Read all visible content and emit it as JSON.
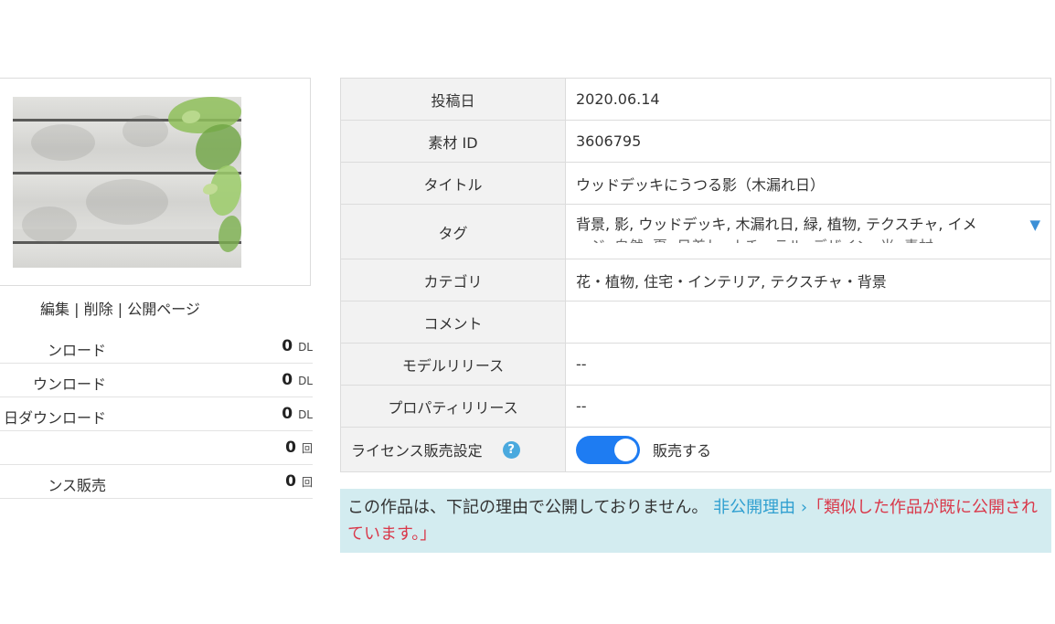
{
  "item_actions": {
    "edit": "編集",
    "separator": "|",
    "delete": "削除",
    "public_page": "公開ページ"
  },
  "stats": [
    {
      "label": "ンロード",
      "value": "0",
      "unit": "DL"
    },
    {
      "label": "ウンロード",
      "value": "0",
      "unit": "DL"
    },
    {
      "label": "日ダウンロード",
      "value": "0",
      "unit": "DL"
    },
    {
      "label": "",
      "value": "0",
      "unit": "回"
    },
    {
      "label": "ンス販売",
      "value": "0",
      "unit": "回"
    }
  ],
  "info": {
    "post_date": {
      "label": "投稿日",
      "value": "2020.06.14"
    },
    "material_id": {
      "label": "素材 ID",
      "value": "3606795"
    },
    "title": {
      "label": "タイトル",
      "value": "ウッドデッキにうつる影（木漏れ日）"
    },
    "tags": {
      "label": "タグ",
      "value": "背景, 影, ウッドデッキ, 木漏れ日, 緑, 植物, テクスチャ, イメ",
      "overflow_hint": "ージ, 自然, 夏, 日差し, ナチュラル, デザイン, 光, 素材",
      "toggle_icon": "▼"
    },
    "category": {
      "label": "カテゴリ",
      "value": "花・植物, 住宅・インテリア, テクスチャ・背景"
    },
    "comment": {
      "label": "コメント",
      "value": ""
    },
    "model_release": {
      "label": "モデルリリース",
      "value": "--"
    },
    "property_release": {
      "label": "プロパティリリース",
      "value": "--"
    },
    "license": {
      "label": "ライセンス販売設定",
      "help_icon": "?",
      "toggle_state": "on",
      "toggle_label": "販売する"
    }
  },
  "notice": {
    "message": "この作品は、下記の理由で公開しておりません。",
    "link": "非公開理由 ›",
    "reason": "「類似した作品が既に公開されています。」"
  },
  "colors": {
    "toggle_on": "#1e7cf2",
    "notice_bg": "#d3ecf0",
    "link": "#2f9fd0",
    "reason": "#d9384a",
    "help_icon": "#4aa9de"
  }
}
